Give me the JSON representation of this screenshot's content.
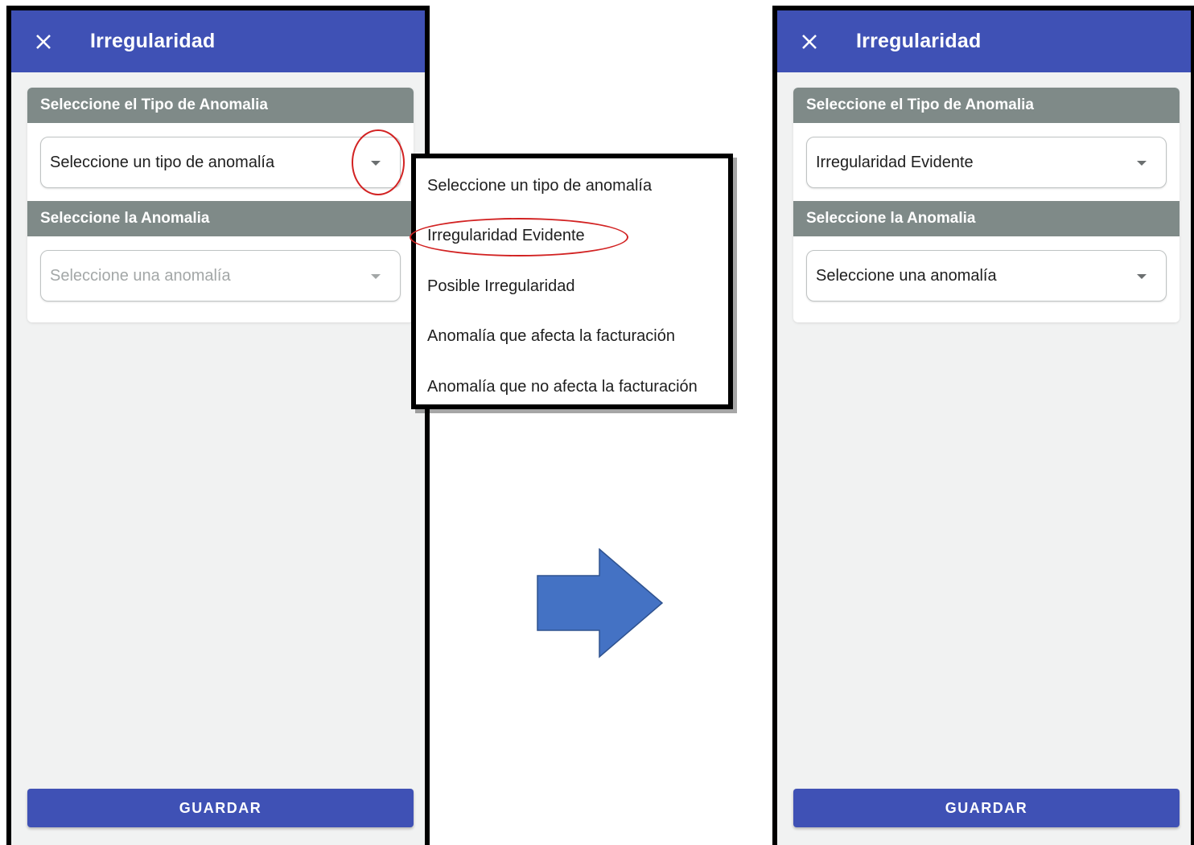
{
  "left_screen": {
    "title": "Irregularidad",
    "section1_title": "Seleccione el Tipo de Anomalia",
    "select1_value": "Seleccione un tipo de anomalía",
    "section2_title": "Seleccione la Anomalia",
    "select2_placeholder": "Seleccione una anomalía",
    "save_label": "GUARDAR"
  },
  "dropdown_menu": {
    "items": [
      "Seleccione un tipo de anomalía",
      "Irregularidad Evidente",
      "Posible Irregularidad",
      "Anomalía que afecta la facturación",
      "Anomalía que no afecta la facturación"
    ],
    "highlighted_item": "Irregularidad Evidente"
  },
  "right_screen": {
    "title": "Irregularidad",
    "section1_title": "Seleccione el Tipo de Anomalia",
    "select1_value": "Irregularidad Evidente",
    "section2_title": "Seleccione la Anomalia",
    "select2_value": "Seleccione una anomalía",
    "save_label": "GUARDAR"
  },
  "colors": {
    "appbar": "#3f51b5",
    "section_header": "#7f8a88",
    "highlight": "#d22222",
    "arrow": "#4472c4"
  },
  "icons": [
    "close-icon",
    "dropdown-caret-icon",
    "right-arrow-icon"
  ]
}
